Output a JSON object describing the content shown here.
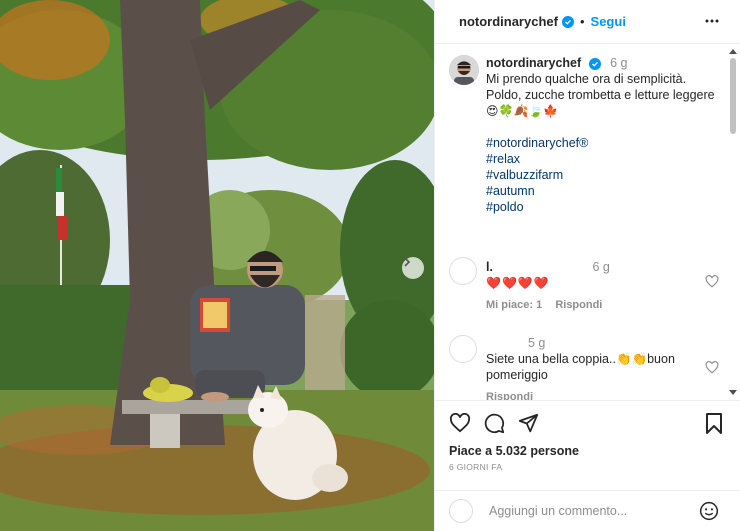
{
  "header": {
    "username": "notordinarychef",
    "separator": "•",
    "follow_label": "Segui"
  },
  "caption": {
    "username": "notordinarychef",
    "time": "6 g",
    "text": "Mi prendo qualche ora di semplicità. Poldo, zucche trombetta e letture leggere",
    "emojis": "😍🍀🍂🍃🍁",
    "hashtags": [
      "#notordinarychef®",
      "#relax",
      "#valbuzzifarm",
      "#autumn",
      "#poldo"
    ]
  },
  "comments": [
    {
      "username": "l.",
      "time": "6 g",
      "text": "❤️❤️❤️❤️",
      "likes_label": "Mi piace: 1",
      "reply_label": "Rispondi"
    },
    {
      "username": "",
      "time": "5 g",
      "text": "Siete una bella coppia..👏👏buon pomeriggio",
      "reply_label": "Rispondi"
    }
  ],
  "actions": {
    "likes_text": "Piace a 5.032 persone",
    "time_ago": "6 GIORNI FA"
  },
  "add_comment": {
    "placeholder": "Aggiungi un commento..."
  },
  "icons": {
    "verified": "verified-badge-icon",
    "more": "more-horizontal-icon",
    "next": "chevron-right-icon",
    "like": "heart-icon",
    "comment": "comment-bubble-icon",
    "share": "paper-plane-icon",
    "save": "bookmark-icon",
    "emoji": "smiley-icon"
  },
  "colors": {
    "accent": "#0095f6",
    "hashtag": "#00376b",
    "heart": "#ed4956",
    "muted": "#8e8e8e"
  }
}
